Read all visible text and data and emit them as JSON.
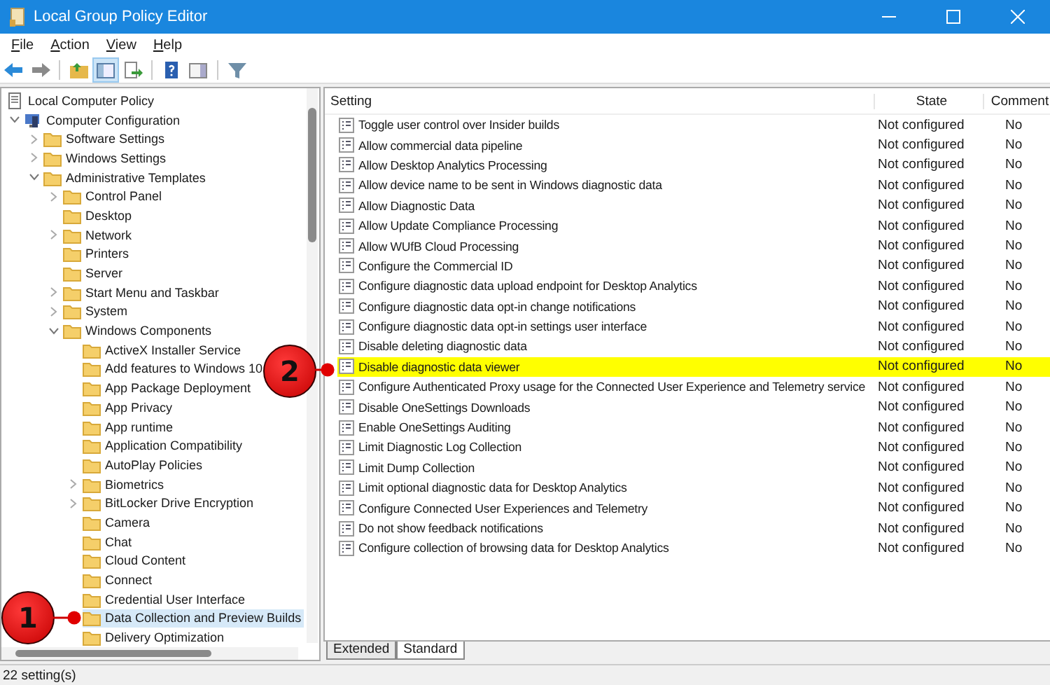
{
  "window": {
    "title": "Local Group Policy Editor"
  },
  "menu": [
    {
      "label": "File"
    },
    {
      "label": "Action"
    },
    {
      "label": "View"
    },
    {
      "label": "Help"
    }
  ],
  "toolbar": [
    {
      "kind": "back",
      "pressed": false
    },
    {
      "kind": "forward",
      "pressed": false
    },
    {
      "kind": "up",
      "pressed": false
    },
    {
      "kind": "tree",
      "pressed": true
    },
    {
      "kind": "export",
      "pressed": false
    },
    {
      "kind": "help",
      "pressed": false
    },
    {
      "kind": "pane",
      "pressed": false
    },
    {
      "kind": "filter",
      "pressed": false
    }
  ],
  "tree": [
    {
      "label": "Local Computer Policy",
      "kind": "policy",
      "selected": false,
      "children": [
        {
          "label": "Computer Configuration",
          "kind": "computer",
          "selected": false,
          "expanded": true,
          "children": [
            {
              "label": "Software Settings",
              "kind": "folder",
              "selected": false,
              "expanded": false
            },
            {
              "label": "Windows Settings",
              "kind": "folder",
              "selected": false,
              "expanded": false
            },
            {
              "label": "Administrative Templates",
              "kind": "folder",
              "selected": false,
              "expanded": true,
              "children": [
                {
                  "label": "Control Panel",
                  "kind": "folder",
                  "selected": false,
                  "expanded": false
                },
                {
                  "label": "Desktop",
                  "kind": "folder",
                  "selected": false
                },
                {
                  "label": "Network",
                  "kind": "folder",
                  "selected": false,
                  "expanded": false
                },
                {
                  "label": "Printers",
                  "kind": "folder",
                  "selected": false
                },
                {
                  "label": "Server",
                  "kind": "folder",
                  "selected": false
                },
                {
                  "label": "Start Menu and Taskbar",
                  "kind": "folder",
                  "selected": false,
                  "expanded": false
                },
                {
                  "label": "System",
                  "kind": "folder",
                  "selected": false,
                  "expanded": false
                },
                {
                  "label": "Windows Components",
                  "kind": "folder",
                  "selected": false,
                  "expanded": true,
                  "children": [
                    {
                      "label": "ActiveX Installer Service",
                      "kind": "folder",
                      "selected": false
                    },
                    {
                      "label": "Add features to Windows 10",
                      "kind": "folder",
                      "selected": false
                    },
                    {
                      "label": "App Package Deployment",
                      "kind": "folder",
                      "selected": false
                    },
                    {
                      "label": "App Privacy",
                      "kind": "folder",
                      "selected": false
                    },
                    {
                      "label": "App runtime",
                      "kind": "folder",
                      "selected": false
                    },
                    {
                      "label": "Application Compatibility",
                      "kind": "folder",
                      "selected": false
                    },
                    {
                      "label": "AutoPlay Policies",
                      "kind": "folder",
                      "selected": false
                    },
                    {
                      "label": "Biometrics",
                      "kind": "folder",
                      "selected": false,
                      "expanded": false
                    },
                    {
                      "label": "BitLocker Drive Encryption",
                      "kind": "folder",
                      "selected": false,
                      "expanded": false
                    },
                    {
                      "label": "Camera",
                      "kind": "folder",
                      "selected": false
                    },
                    {
                      "label": "Chat",
                      "kind": "folder",
                      "selected": false
                    },
                    {
                      "label": "Cloud Content",
                      "kind": "folder",
                      "selected": false
                    },
                    {
                      "label": "Connect",
                      "kind": "folder",
                      "selected": false
                    },
                    {
                      "label": "Credential User Interface",
                      "kind": "folder",
                      "selected": false
                    },
                    {
                      "label": "Data Collection and Preview Builds",
                      "kind": "folder",
                      "selected": true
                    },
                    {
                      "label": "Delivery Optimization",
                      "kind": "folder",
                      "selected": false
                    }
                  ]
                }
              ]
            }
          ]
        }
      ]
    }
  ],
  "settings_list": {
    "columns": [
      "Setting",
      "State",
      "Comment"
    ],
    "rows": [
      {
        "setting": "Toggle user control over Insider builds",
        "state": "Not configured",
        "comment": "No",
        "highlighted": false
      },
      {
        "setting": "Allow commercial data pipeline",
        "state": "Not configured",
        "comment": "No",
        "highlighted": false
      },
      {
        "setting": "Allow Desktop Analytics Processing",
        "state": "Not configured",
        "comment": "No",
        "highlighted": false
      },
      {
        "setting": "Allow device name to be sent in Windows diagnostic data",
        "state": "Not configured",
        "comment": "No",
        "highlighted": false
      },
      {
        "setting": "Allow Diagnostic Data",
        "state": "Not configured",
        "comment": "No",
        "highlighted": false
      },
      {
        "setting": "Allow Update Compliance Processing",
        "state": "Not configured",
        "comment": "No",
        "highlighted": false
      },
      {
        "setting": "Allow WUfB Cloud Processing",
        "state": "Not configured",
        "comment": "No",
        "highlighted": false
      },
      {
        "setting": "Configure the Commercial ID",
        "state": "Not configured",
        "comment": "No",
        "highlighted": false
      },
      {
        "setting": "Configure diagnostic data upload endpoint for Desktop Analytics",
        "state": "Not configured",
        "comment": "No",
        "highlighted": false
      },
      {
        "setting": "Configure diagnostic data opt-in change notifications",
        "state": "Not configured",
        "comment": "No",
        "highlighted": false
      },
      {
        "setting": "Configure diagnostic data opt-in settings user interface",
        "state": "Not configured",
        "comment": "No",
        "highlighted": false
      },
      {
        "setting": "Disable deleting diagnostic data",
        "state": "Not configured",
        "comment": "No",
        "highlighted": false
      },
      {
        "setting": "Disable diagnostic data viewer",
        "state": "Not configured",
        "comment": "No",
        "highlighted": true
      },
      {
        "setting": "Configure Authenticated Proxy usage for the Connected User Experience and Telemetry service",
        "state": "Not configured",
        "comment": "No",
        "highlighted": false
      },
      {
        "setting": "Disable OneSettings Downloads",
        "state": "Not configured",
        "comment": "No",
        "highlighted": false
      },
      {
        "setting": "Enable OneSettings Auditing",
        "state": "Not configured",
        "comment": "No",
        "highlighted": false
      },
      {
        "setting": "Limit Diagnostic Log Collection",
        "state": "Not configured",
        "comment": "No",
        "highlighted": false
      },
      {
        "setting": "Limit Dump Collection",
        "state": "Not configured",
        "comment": "No",
        "highlighted": false
      },
      {
        "setting": "Limit optional diagnostic data for Desktop Analytics",
        "state": "Not configured",
        "comment": "No",
        "highlighted": false
      },
      {
        "setting": "Configure Connected User Experiences and Telemetry",
        "state": "Not configured",
        "comment": "No",
        "highlighted": false
      },
      {
        "setting": "Do not show feedback notifications",
        "state": "Not configured",
        "comment": "No",
        "highlighted": false
      },
      {
        "setting": "Configure collection of browsing data for Desktop Analytics",
        "state": "Not configured",
        "comment": "No",
        "highlighted": false
      }
    ]
  },
  "view_tabs": [
    {
      "label": "Extended",
      "selected": false
    },
    {
      "label": "Standard",
      "selected": true
    }
  ],
  "status_bar": {
    "text": "22 setting(s)"
  },
  "annotations": [
    {
      "label": "1"
    },
    {
      "label": "2"
    }
  ]
}
